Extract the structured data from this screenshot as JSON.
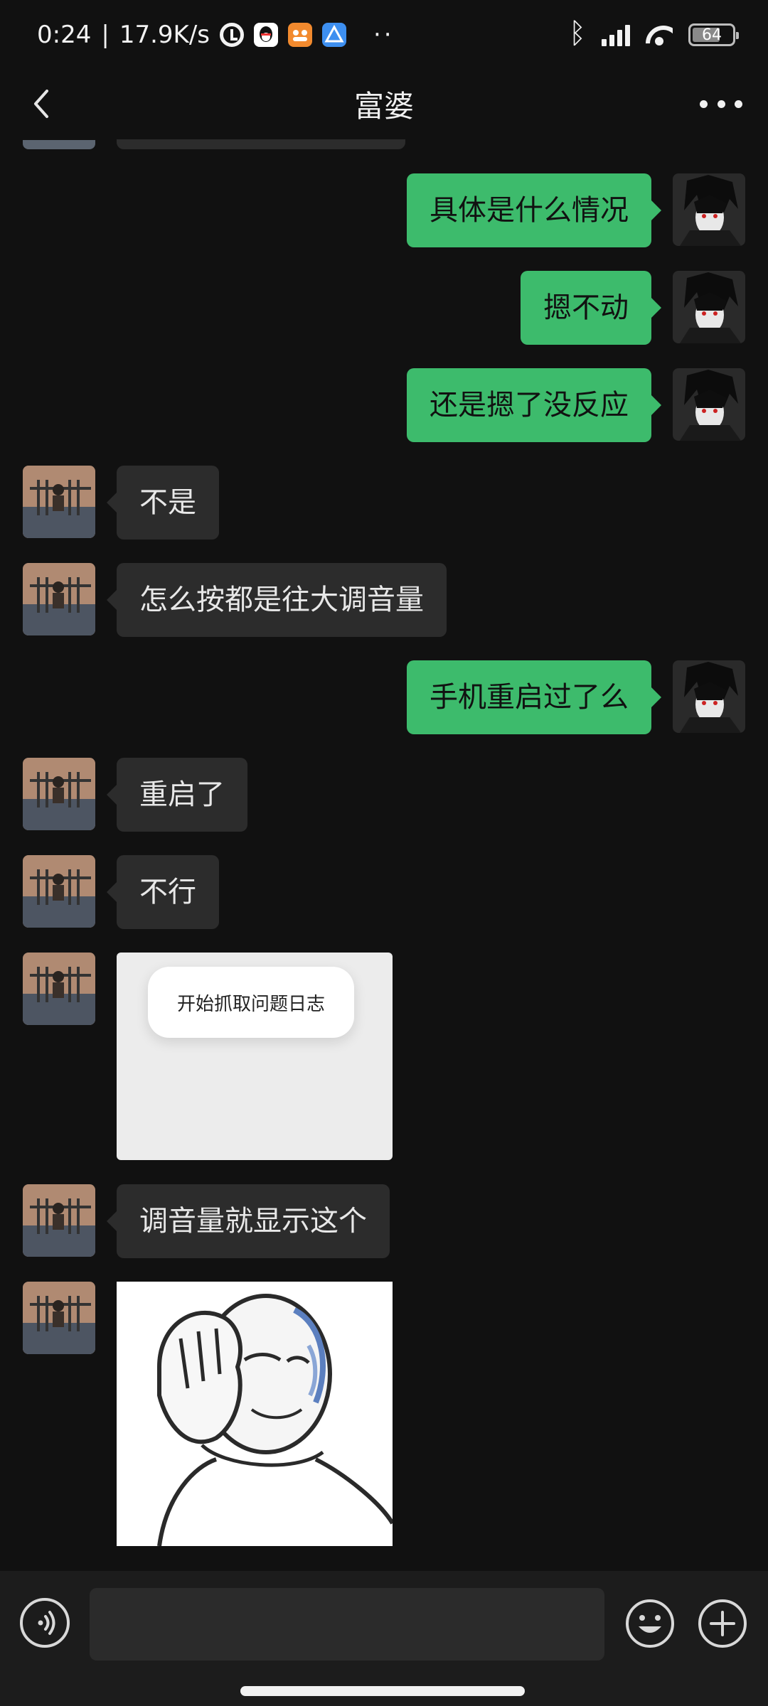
{
  "status_bar": {
    "time": "0:24",
    "separator": "|",
    "net_speed": "17.9K/s",
    "dots": "··",
    "battery_level": "64",
    "icons": [
      "alarm-icon",
      "qq-icon",
      "app-orange-icon",
      "app-blue-icon",
      "bluetooth-icon",
      "signal-icon",
      "wifi-icon",
      "battery-icon"
    ]
  },
  "header": {
    "title": "富婆",
    "back_icon": "chevron-left-icon",
    "more_icon": "more-dots-icon"
  },
  "colors": {
    "background": "#111111",
    "incoming_bubble": "#2c2c2c",
    "outgoing_bubble": "#3dbb6c",
    "input_bar": "#1c1c1c"
  },
  "messages": [
    {
      "side": "out",
      "type": "text",
      "text": "具体是什么情况"
    },
    {
      "side": "out",
      "type": "text",
      "text": "摁不动"
    },
    {
      "side": "out",
      "type": "text",
      "text": "还是摁了没反应"
    },
    {
      "side": "in",
      "type": "text",
      "text": "不是"
    },
    {
      "side": "in",
      "type": "text",
      "text": "怎么按都是往大调音量"
    },
    {
      "side": "out",
      "type": "text",
      "text": "手机重启过了么"
    },
    {
      "side": "in",
      "type": "text",
      "text": "重启了"
    },
    {
      "side": "in",
      "type": "text",
      "text": "不行"
    },
    {
      "side": "in",
      "type": "image",
      "caption_text": "开始抓取问题日志"
    },
    {
      "side": "in",
      "type": "text",
      "text": "调音量就显示这个"
    },
    {
      "side": "in",
      "type": "sticker",
      "description_icon": "facepalm-meme-sticker"
    }
  ],
  "input_bar": {
    "voice_icon": "voice-icon",
    "text_value": "",
    "emoji_icon": "emoji-icon",
    "plus_icon": "plus-icon"
  }
}
